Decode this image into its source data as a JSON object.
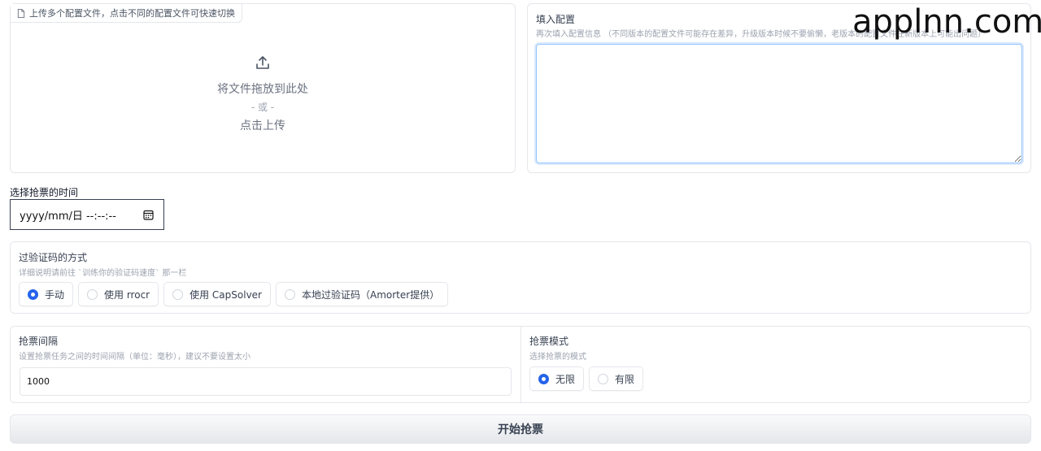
{
  "upload": {
    "tag": "上传多个配置文件，点击不同的配置文件可快速切换",
    "drop_text": "将文件拖放到此处",
    "or_text": "- 或 -",
    "click_text": "点击上传"
  },
  "config": {
    "label": "填入配置",
    "hint": "再次填入配置信息 （不同版本的配置文件可能存在差异，升级版本时候不要偷懒，老版本的配置文件在新版本上可能出问题）",
    "value": ""
  },
  "watermark": "applnn.com",
  "date": {
    "label": "选择抢票的时间",
    "placeholder": "yyyy/mm/日 --:--:--"
  },
  "captcha": {
    "label": "过验证码的方式",
    "hint": "详细说明请前往 `训练你的验证码速度` 那一栏",
    "options": [
      {
        "label": "手动",
        "checked": true
      },
      {
        "label": "使用 rrocr",
        "checked": false
      },
      {
        "label": "使用 CapSolver",
        "checked": false
      },
      {
        "label": "本地过验证码（Amorter提供）",
        "checked": false
      }
    ]
  },
  "interval": {
    "label": "抢票间隔",
    "hint": "设置抢票任务之间的时间间隔（单位：毫秒），建议不要设置太小",
    "value": "1000"
  },
  "mode": {
    "label": "抢票模式",
    "hint": "选择抢票的模式",
    "options": [
      {
        "label": "无限",
        "checked": true
      },
      {
        "label": "有限",
        "checked": false
      }
    ]
  },
  "start_button": "开始抢票",
  "colors": {
    "accent": "#2563eb",
    "border": "#e5e7eb"
  }
}
